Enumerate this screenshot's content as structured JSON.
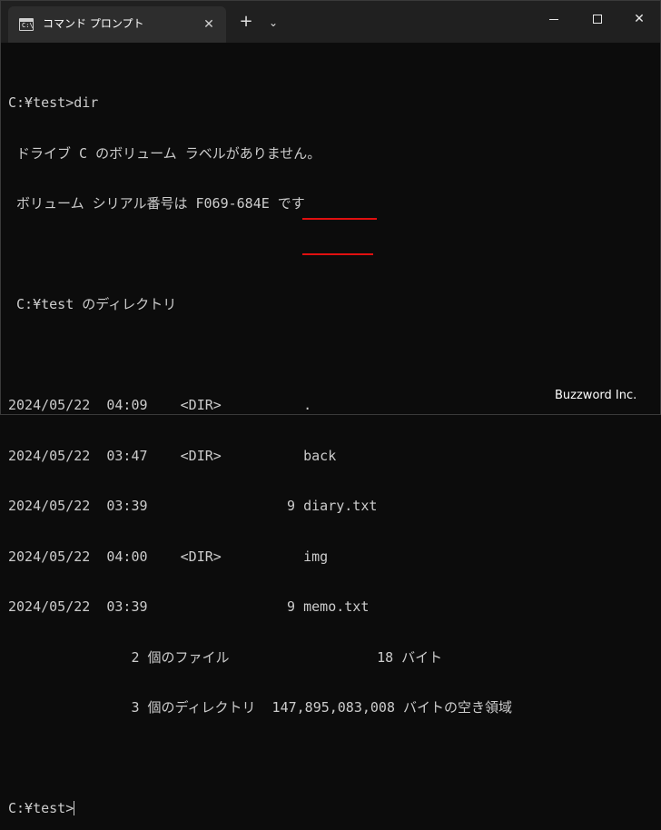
{
  "titlebar": {
    "tab_title": "コマンド プロンプト",
    "tab_icon_glyph": "C:\\",
    "tab_close": "✕",
    "new_tab": "+",
    "dropdown": "⌄",
    "close_symbol": "✕"
  },
  "terminal": {
    "lines": [
      "",
      "C:¥test>dir",
      " ドライブ C のボリューム ラベルがありません。",
      " ボリューム シリアル番号は F069-684E です",
      "",
      " C:¥test のディレクトリ",
      "",
      "2024/05/22  04:09    <DIR>          .",
      "2024/05/22  03:47    <DIR>          back",
      "2024/05/22  03:39                 9 diary.txt",
      "2024/05/22  04:00    <DIR>          img",
      "2024/05/22  03:39                 9 memo.txt",
      "               2 個のファイル                  18 バイト",
      "               3 個のディレクトリ  147,895,083,008 バイトの空き領域",
      "",
      "C:¥test>"
    ]
  },
  "accent": {
    "underline_color": "#e01010"
  },
  "watermark": "Buzzword Inc."
}
